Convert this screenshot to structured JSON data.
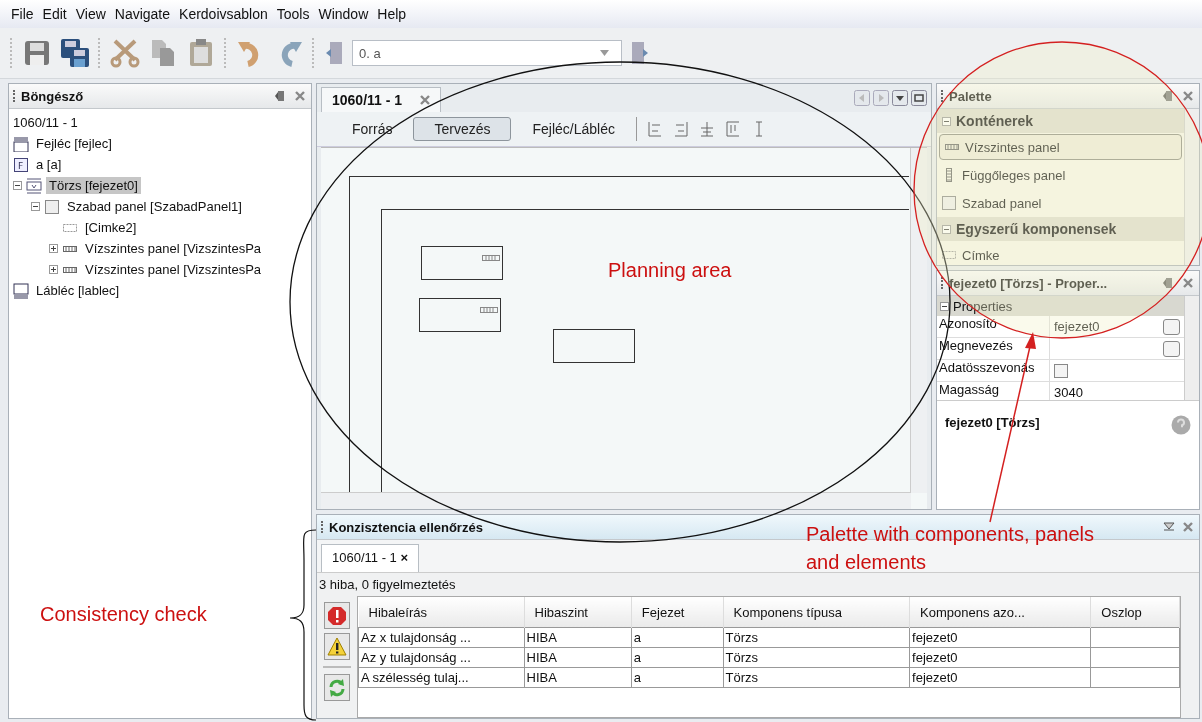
{
  "menu": [
    "File",
    "Edit",
    "View",
    "Navigate",
    "Kerdoivsablon",
    "Tools",
    "Window",
    "Help"
  ],
  "toolbar": {
    "combo_value": "0. a"
  },
  "browser": {
    "title": "Böngésző",
    "root": "1060/11 - 1",
    "items": [
      {
        "label": "Fejléc [fejlec]",
        "kind": "header"
      },
      {
        "label": "a [a]",
        "kind": "chapter",
        "icon_letter": "F"
      },
      {
        "label": "Törzs [fejezet0]",
        "kind": "body",
        "selected": true,
        "expanded": true,
        "children": [
          {
            "label": "Szabad panel [SzabadPanel1]",
            "kind": "free",
            "selected": false,
            "expanded": true,
            "children": [
              {
                "label": "[Cimke2]",
                "kind": "label",
                "selected": false
              },
              {
                "label": "Vízszintes panel [VizszintesPa",
                "kind": "hpanel",
                "selected": false,
                "expanded": false
              },
              {
                "label": "Vízszintes panel [VizszintesPa",
                "kind": "hpanel",
                "selected": false,
                "expanded": false
              }
            ]
          }
        ]
      },
      {
        "label": "Lábléc [lablec]",
        "kind": "footer"
      }
    ]
  },
  "editor": {
    "tab": "1060/11 - 1",
    "views": [
      {
        "label": "Forrás",
        "selected": false
      },
      {
        "label": "Tervezés",
        "selected": true
      },
      {
        "label": "Fejléc/Lábléc",
        "selected": false
      }
    ]
  },
  "palette": {
    "title": "Palette",
    "groups": [
      {
        "label": "Konténerek",
        "expanded": true,
        "items": [
          {
            "label": "Vízszintes panel",
            "kind": "hpanel",
            "selected": true
          },
          {
            "label": "Függőleges panel",
            "kind": "vpanel",
            "selected": false
          },
          {
            "label": "Szabad panel",
            "kind": "free",
            "selected": false
          }
        ]
      },
      {
        "label": "Egyszerű komponensek",
        "expanded": true,
        "items": [
          {
            "label": "Címke",
            "kind": "label",
            "selected": false
          }
        ]
      }
    ]
  },
  "properties": {
    "title": "fejezet0 [Törzs] - Proper...",
    "group": "Properties",
    "expanded": true,
    "rows": [
      {
        "name": "Azonosító",
        "kind": "text",
        "value": "fejezet0"
      },
      {
        "name": "Megnevezés",
        "kind": "text"
      },
      {
        "name": "Adatösszevonás",
        "kind": "checkbox",
        "checked": false
      },
      {
        "name": "Magasság",
        "kind": "plain",
        "value": "3040"
      }
    ],
    "description": "fejezet0 [Törzs]"
  },
  "consistency": {
    "title": "Konzisztencia ellenőrzés",
    "tab": "1060/11 - 1",
    "tab_close": "×",
    "summary": "3 hiba, 0 figyelmeztetés",
    "columns": [
      "Hibaleírás",
      "Hibaszint",
      "Fejezet",
      "Komponens típusa",
      "Komponens azo...",
      "Oszlop"
    ],
    "rows": [
      [
        "Az x tulajdonság ...",
        "HIBA",
        "a",
        "Törzs",
        "fejezet0",
        ""
      ],
      [
        "Az y tulajdonság ...",
        "HIBA",
        "a",
        "Törzs",
        "fejezet0",
        ""
      ],
      [
        "A szélesség tulaj...",
        "HIBA",
        "a",
        "Törzs",
        "fejezet0",
        ""
      ]
    ]
  },
  "annotations": [
    {
      "kind": "planning",
      "text": "Planning area"
    },
    {
      "kind": "palette",
      "text": "Palette with components, panels and elements"
    },
    {
      "kind": "consistency",
      "text": "Consistency check"
    }
  ]
}
